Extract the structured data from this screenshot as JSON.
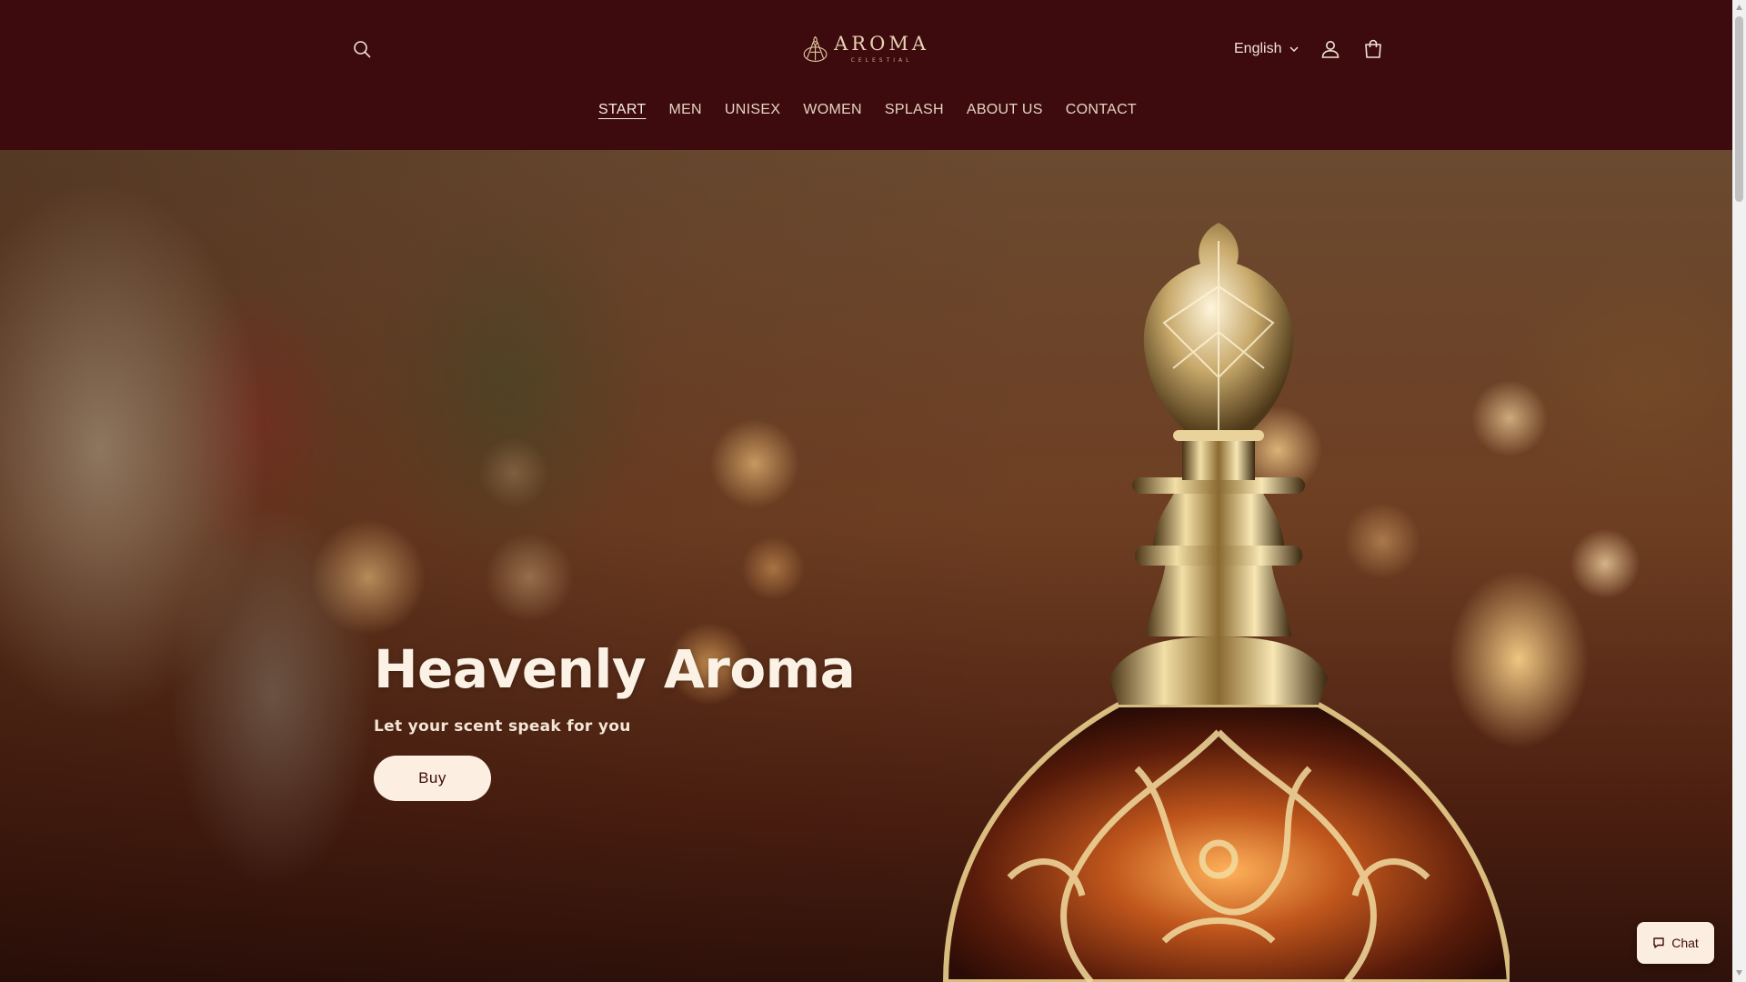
{
  "header": {
    "logo": {
      "word": "AROMA",
      "sub": "CELESTIAL"
    },
    "language": "English",
    "icons": {
      "search": "search-icon",
      "account": "account-icon",
      "cart": "cart-icon",
      "chevron": "chevron-down-icon"
    }
  },
  "nav": [
    {
      "label": "START",
      "active": true
    },
    {
      "label": "MEN"
    },
    {
      "label": "UNISEX"
    },
    {
      "label": "WOMEN"
    },
    {
      "label": "SPLASH"
    },
    {
      "label": "ABOUT US"
    },
    {
      "label": "CONTACT"
    }
  ],
  "hero": {
    "title": "Heavenly Aroma",
    "subtitle": "Let your scent speak for you",
    "button": "Buy"
  },
  "chat": {
    "label": "Chat",
    "icon": "chat-icon"
  },
  "colors": {
    "header_bg": "#3d0b0d",
    "button_bg": "#fcefe2",
    "button_text": "#3d0b0d",
    "text_light": "#fbf1e4"
  }
}
